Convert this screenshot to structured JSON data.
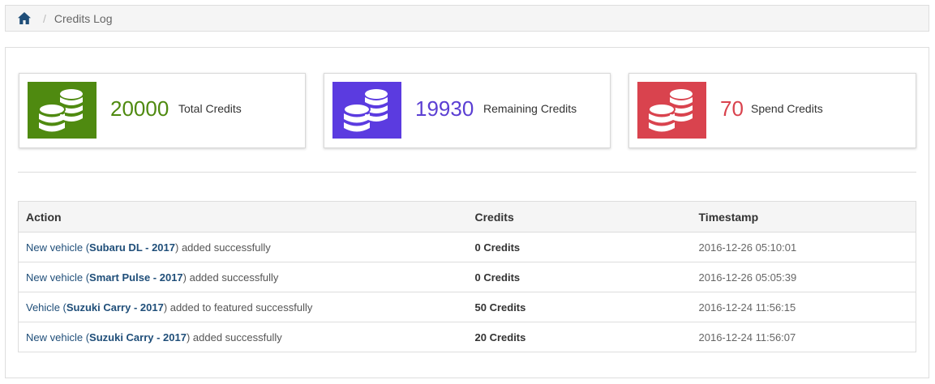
{
  "breadcrumb": {
    "current": "Credits Log"
  },
  "stats": [
    {
      "value": "20000",
      "label": "Total Credits",
      "color": "#4f8a10",
      "icon_bg": "#4f8a10"
    },
    {
      "value": "19930",
      "label": "Remaining Credits",
      "color": "#5b3fd3",
      "icon_bg": "#5b3be0"
    },
    {
      "value": "70",
      "label": "Spend Credits",
      "color": "#d9434e",
      "icon_bg": "#d9434e"
    }
  ],
  "table": {
    "headers": [
      "Action",
      "Credits",
      "Timestamp"
    ],
    "rows": [
      {
        "pre": "New vehicle (",
        "vehicle": "Subaru DL - 2017",
        "post": ") added successfully",
        "credits": "0 Credits",
        "timestamp": "2016-12-26 05:10:01"
      },
      {
        "pre": "New vehicle (",
        "vehicle": "Smart Pulse - 2017",
        "post": ") added successfully",
        "credits": "0 Credits",
        "timestamp": "2016-12-26 05:05:39"
      },
      {
        "pre": "Vehicle (",
        "vehicle": "Suzuki Carry - 2017",
        "post": ") added to featured successfully",
        "credits": "50 Credits",
        "timestamp": "2016-12-24 11:56:15"
      },
      {
        "pre": "New vehicle (",
        "vehicle": "Suzuki Carry - 2017",
        "post": ") added successfully",
        "credits": "20 Credits",
        "timestamp": "2016-12-24 11:56:07"
      }
    ]
  },
  "icons": {
    "home": "home-icon",
    "coins": "coins-icon"
  }
}
